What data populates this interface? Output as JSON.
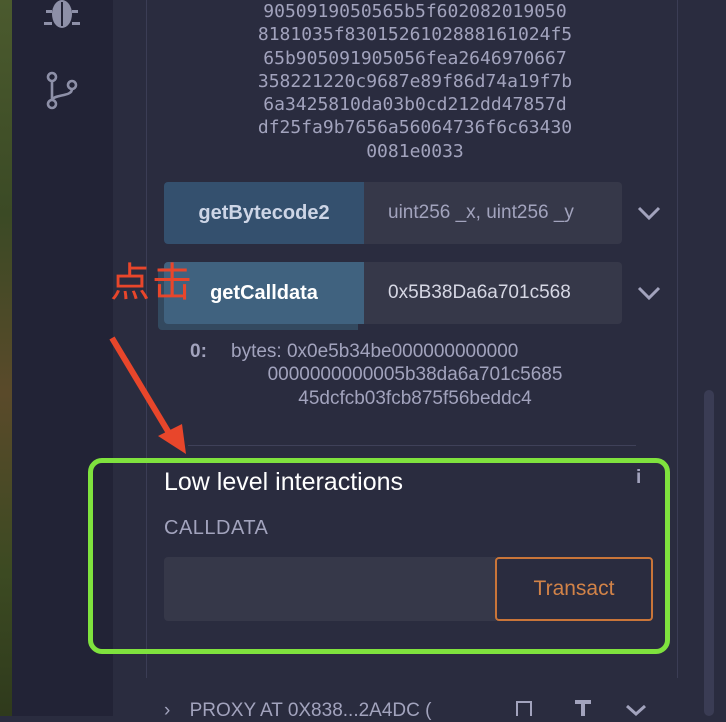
{
  "sidebar": {
    "icons": [
      "bug-icon",
      "git-branch-icon"
    ]
  },
  "bytecode_output": {
    "lines": [
      "9050919050565b5f602082019050",
      "8181035f8301526102888161024f5",
      "65b905091905056fea2646970667",
      "358221220c9687e89f86d74a19f7b",
      "6a3425810da03b0cd212dd47857d",
      "df25fa9b7656a56064736f6c63430",
      "0081e0033"
    ]
  },
  "functions": [
    {
      "label": "getBytecode2",
      "input_placeholder": "uint256 _x, uint256 _y",
      "input_value": ""
    },
    {
      "label": "getCalldata",
      "input_placeholder": "",
      "input_value": "0x5B38Da6a701c568"
    }
  ],
  "result": {
    "index": "0:",
    "lines": [
      "bytes: 0x0e5b34be000000000000",
      "0000000000005b38da6a701c5685",
      "45dcfcb03fcb875f56beddc4"
    ]
  },
  "low_level": {
    "title": "Low level interactions",
    "badge": "i",
    "calldata_label": "CALLDATA",
    "calldata_value": "",
    "transact_label": "Transact"
  },
  "annotation": {
    "text": "点击",
    "color": "#e8462b",
    "highlight_color": "#7fe23e"
  },
  "proxy_row": {
    "text": "PROXY AT 0X838...2A4DC (",
    "icons": [
      "chevron-right-icon",
      "copy-icon",
      "pin-icon",
      "chevron-down-icon"
    ]
  },
  "colors": {
    "panel_bg": "#2a2c3f",
    "button_blue": "#34506e",
    "transact_orange": "#c97539"
  }
}
